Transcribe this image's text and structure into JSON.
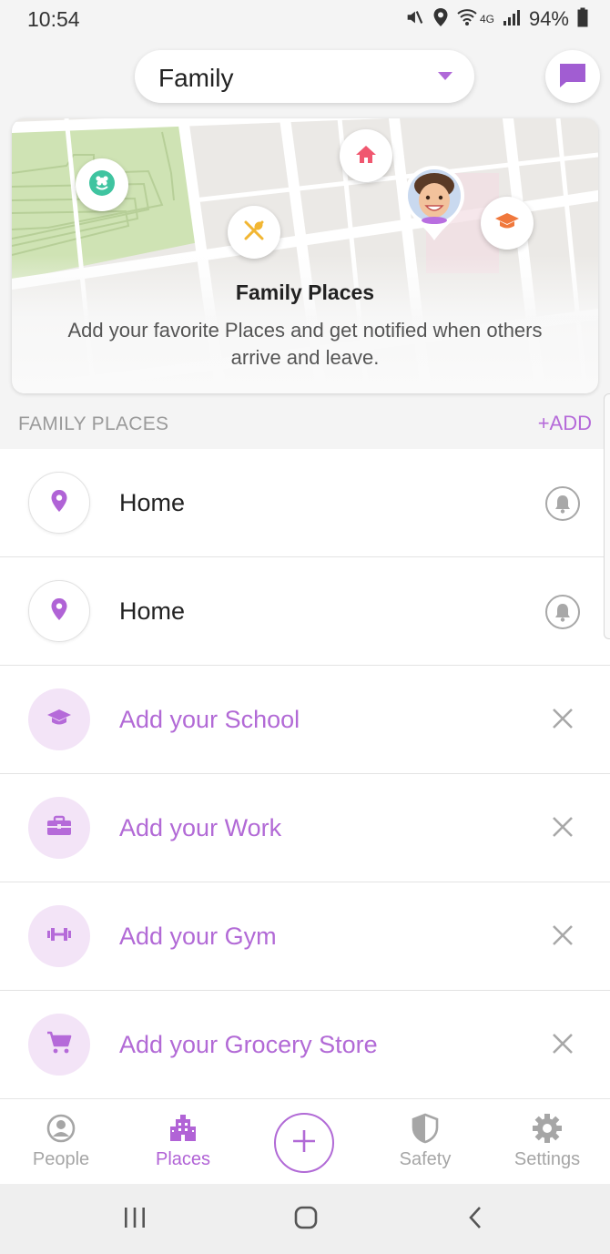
{
  "status_bar": {
    "time": "10:54",
    "network": "4G",
    "battery": "94%",
    "icons": [
      "mute-icon",
      "location-icon",
      "wifi-icon",
      "signal-icon",
      "battery-icon"
    ]
  },
  "header": {
    "circle_name": "Family",
    "chat_icon": "chat-bubble-icon"
  },
  "map_card": {
    "title": "Family Places",
    "description": "Add your favorite Places and get notified when others arrive and leave.",
    "pins": [
      "park-flower-icon",
      "home-icon",
      "restaurant-icon",
      "school-cap-icon",
      "avatar-photo"
    ]
  },
  "places_section": {
    "label": "FAMILY PLACES",
    "add_label": "+ADD"
  },
  "places": [
    {
      "title": "Home",
      "icon": "location-pin-icon",
      "style": "saved",
      "action": "bell-icon"
    },
    {
      "title": "Home",
      "icon": "location-pin-icon",
      "style": "saved",
      "action": "bell-icon"
    },
    {
      "title": "Add your School",
      "icon": "school-cap-icon",
      "style": "suggested",
      "action": "close-icon"
    },
    {
      "title": "Add your Work",
      "icon": "briefcase-icon",
      "style": "suggested",
      "action": "close-icon"
    },
    {
      "title": "Add your Gym",
      "icon": "dumbbell-icon",
      "style": "suggested",
      "action": "close-icon"
    },
    {
      "title": "Add your Grocery Store",
      "icon": "cart-icon",
      "style": "suggested",
      "action": "close-icon"
    }
  ],
  "bottom_nav": {
    "items": [
      {
        "label": "People",
        "icon": "person-icon",
        "active": false
      },
      {
        "label": "Places",
        "icon": "buildings-icon",
        "active": true
      },
      {
        "label": "",
        "icon": "plus-icon",
        "active": false
      },
      {
        "label": "Safety",
        "icon": "shield-icon",
        "active": false
      },
      {
        "label": "Settings",
        "icon": "gear-icon",
        "active": false
      }
    ]
  },
  "system_nav": [
    "recents-icon",
    "home-circle-icon",
    "back-icon"
  ],
  "colors": {
    "accent": "#b56ad9",
    "accent_light": "#f3e4f7",
    "text_dark": "#222222",
    "muted": "#9a9a9a",
    "home_pin": "#f0576f",
    "park_pin": "#3fc4a0",
    "food_pin": "#f2b632",
    "school_pin": "#f0783c"
  }
}
